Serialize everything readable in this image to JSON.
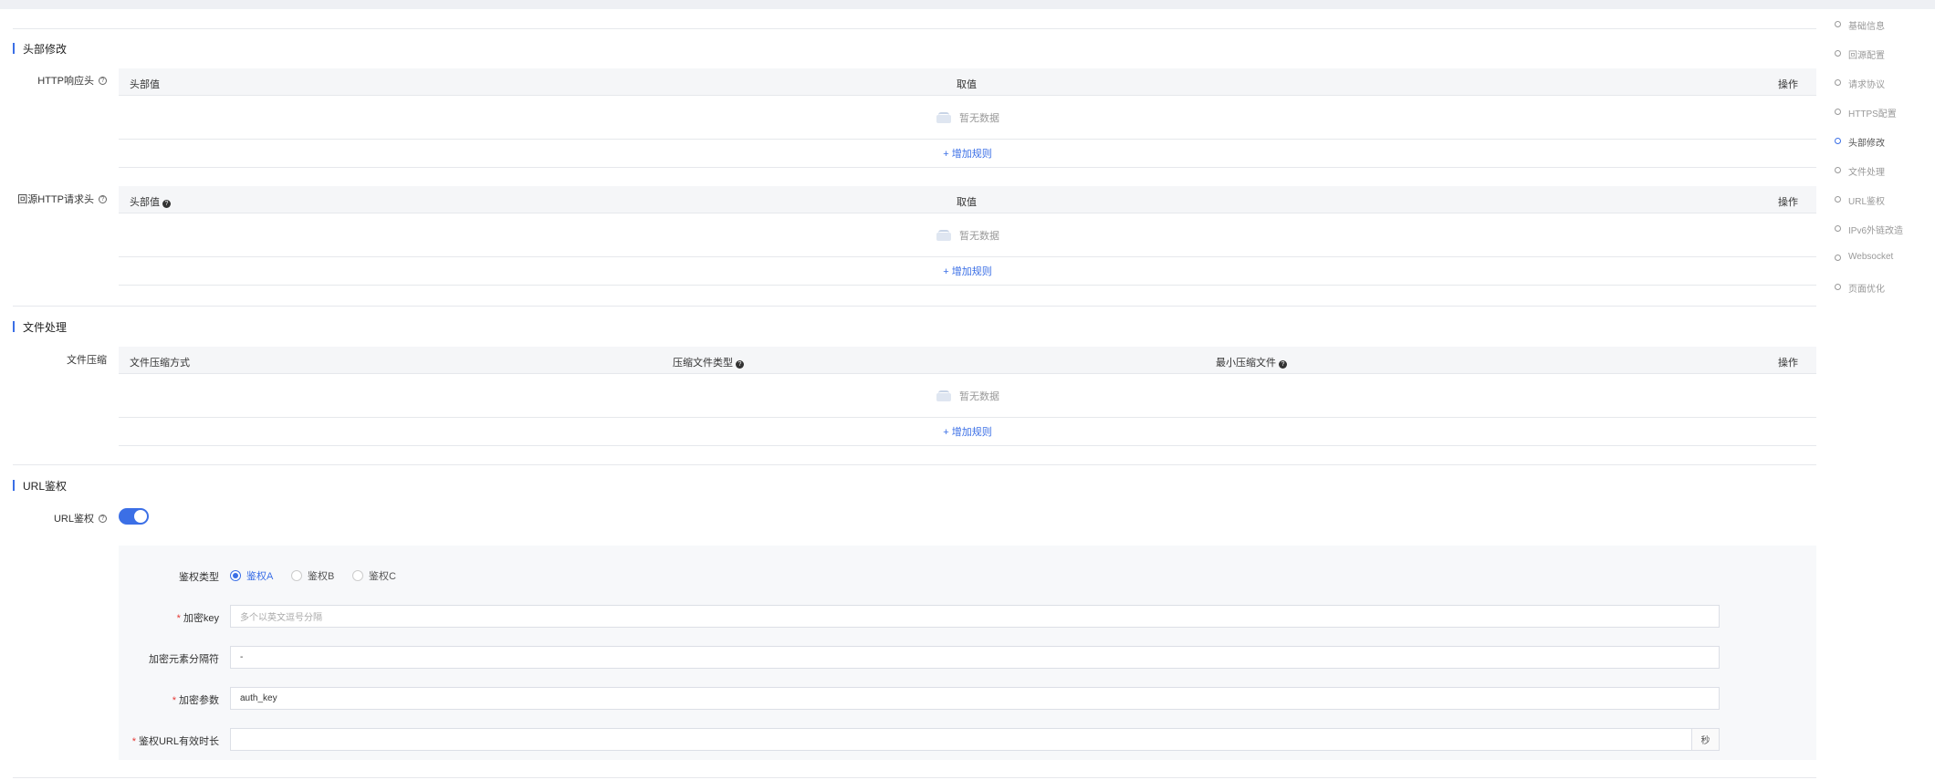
{
  "anchor_nav": {
    "items": [
      {
        "label": "基础信息"
      },
      {
        "label": "回源配置"
      },
      {
        "label": "请求协议"
      },
      {
        "label": "HTTPS配置"
      },
      {
        "label": "头部修改"
      },
      {
        "label": "文件处理"
      },
      {
        "label": "URL鉴权"
      },
      {
        "label": "IPv6外链改造"
      },
      {
        "label": "Websocket"
      },
      {
        "label": "页面优化"
      }
    ],
    "active_index": 4
  },
  "header_section": {
    "title": "头部修改",
    "response_header": {
      "label": "HTTP响应头",
      "columns": [
        "头部值",
        "取值",
        "操作"
      ],
      "empty_text": "暂无数据",
      "add_label": "+ 增加规则"
    },
    "origin_request_header": {
      "label": "回源HTTP请求头",
      "columns": [
        "头部值",
        "取值",
        "操作"
      ],
      "empty_text": "暂无数据",
      "add_label": "+ 增加规则"
    }
  },
  "file_section": {
    "title": "文件处理",
    "compression": {
      "label": "文件压缩",
      "columns": [
        "文件压缩方式",
        "压缩文件类型",
        "最小压缩文件",
        "操作"
      ],
      "empty_text": "暂无数据",
      "add_label": "+ 增加规则"
    }
  },
  "url_auth_section": {
    "title": "URL鉴权",
    "toggle_label": "URL鉴权",
    "toggle_on": true,
    "auth_type_label": "鉴权类型",
    "auth_types": [
      "鉴权A",
      "鉴权B",
      "鉴权C"
    ],
    "auth_type_selected": "鉴权A",
    "key_label": "加密key",
    "key_placeholder": "多个以英文逗号分隔",
    "separator_label": "加密元素分隔符",
    "separator_value": "-",
    "param_label": "加密参数",
    "param_value": "auth_key",
    "duration_label": "鉴权URL有效时长",
    "duration_value": "",
    "duration_unit": "秒"
  },
  "colors": {
    "accent": "#3b6fe6",
    "required": "#e53935",
    "table_header_bg": "#f5f6f8",
    "panel_bg": "#f7f8fa"
  }
}
